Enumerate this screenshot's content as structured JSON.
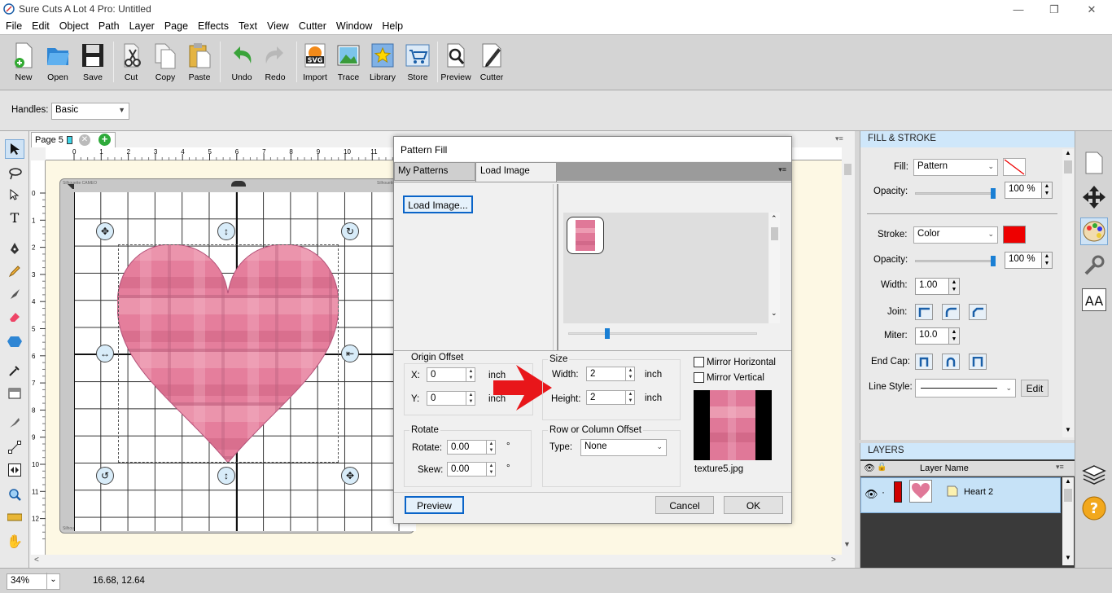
{
  "window": {
    "title": "Sure Cuts A Lot 4 Pro: Untitled",
    "minimize": "—",
    "maximize": "❐",
    "close": "✕"
  },
  "menu": [
    "File",
    "Edit",
    "Object",
    "Path",
    "Layer",
    "Page",
    "Effects",
    "Text",
    "View",
    "Cutter",
    "Window",
    "Help"
  ],
  "toolbar": {
    "items": [
      {
        "label": "New",
        "icon": "new-doc-icon"
      },
      {
        "label": "Open",
        "icon": "open-folder-icon"
      },
      {
        "label": "Save",
        "icon": "floppy-disk-icon"
      },
      {
        "label": "Cut",
        "icon": "scissors-icon"
      },
      {
        "label": "Copy",
        "icon": "copy-icon"
      },
      {
        "label": "Paste",
        "icon": "paste-icon"
      },
      {
        "label": "Undo",
        "icon": "undo-icon"
      },
      {
        "label": "Redo",
        "icon": "redo-icon"
      },
      {
        "label": "Import",
        "icon": "svg-import-icon"
      },
      {
        "label": "Trace",
        "icon": "trace-picture-icon"
      },
      {
        "label": "Library",
        "icon": "library-star-icon"
      },
      {
        "label": "Store",
        "icon": "store-cart-icon"
      },
      {
        "label": "Preview",
        "icon": "preview-magnifier-icon"
      },
      {
        "label": "Cutter",
        "icon": "cutter-pen-icon"
      }
    ]
  },
  "props": {
    "handles_label": "Handles:",
    "handles_value": "Basic"
  },
  "page_tab": {
    "label": "Page 5"
  },
  "ruler": {
    "h_ticks": [
      "0",
      "1",
      "2",
      "3",
      "4",
      "5",
      "6",
      "7",
      "8",
      "9",
      "10",
      "11"
    ],
    "v_ticks": [
      "0",
      "1",
      "2",
      "3",
      "4",
      "5",
      "6",
      "7",
      "8",
      "9",
      "10",
      "11",
      "12"
    ],
    "brand_left": "Silhouette CAMEO",
    "brand_right": "Silhouette CAMEO"
  },
  "status": {
    "zoom": "34%",
    "coords": "16.68, 12.64"
  },
  "dialog": {
    "title": "Pattern Fill",
    "tabs": [
      "My Patterns",
      "Load Image"
    ],
    "active_tab": "Load Image",
    "load_image_button": "Load Image...",
    "origin_offset": {
      "title": "Origin Offset",
      "x_label": "X:",
      "x_value": "0",
      "y_label": "Y:",
      "y_value": "0",
      "unit": "inch"
    },
    "size": {
      "title": "Size",
      "width_label": "Width:",
      "width_value": "2",
      "height_label": "Height:",
      "height_value": "2",
      "unit": "inch"
    },
    "mirror_horizontal": "Mirror Horizontal",
    "mirror_vertical": "Mirror Vertical",
    "rotate": {
      "title": "Rotate",
      "rotate_label": "Rotate:",
      "rotate_value": "0.00",
      "skew_label": "Skew:",
      "skew_value": "0.00",
      "unit": "°"
    },
    "offset": {
      "title": "Row or Column Offset",
      "type_label": "Type:",
      "type_value": "None"
    },
    "texture_name": "texture5.jpg",
    "preview_button": "Preview",
    "cancel_button": "Cancel",
    "ok_button": "OK",
    "arrow_color": "#e8161a"
  },
  "fill_stroke": {
    "header": "FILL & STROKE",
    "fill_label": "Fill:",
    "fill_value": "Pattern",
    "fill_opacity_label": "Opacity:",
    "fill_opacity_value": "100 %",
    "fill_opacity_level": 1.0,
    "stroke_label": "Stroke:",
    "stroke_value": "Color",
    "stroke_color": "#ee0000",
    "stroke_opacity_label": "Opacity:",
    "stroke_opacity_value": "100 %",
    "stroke_opacity_level": 1.0,
    "width_label": "Width:",
    "width_value": "1.00",
    "join_label": "Join:",
    "miter_label": "Miter:",
    "miter_value": "10.0",
    "endcap_label": "End Cap:",
    "linestyle_label": "Line Style:",
    "edit_button": "Edit"
  },
  "layers": {
    "header": "LAYERS",
    "column": "Layer Name",
    "row_name": "Heart 2",
    "row_color": "#d00000"
  },
  "colors": {
    "accent": "#1a7fd4",
    "panel_header": "#cfe7fa",
    "heart_pink": "#e07898"
  }
}
